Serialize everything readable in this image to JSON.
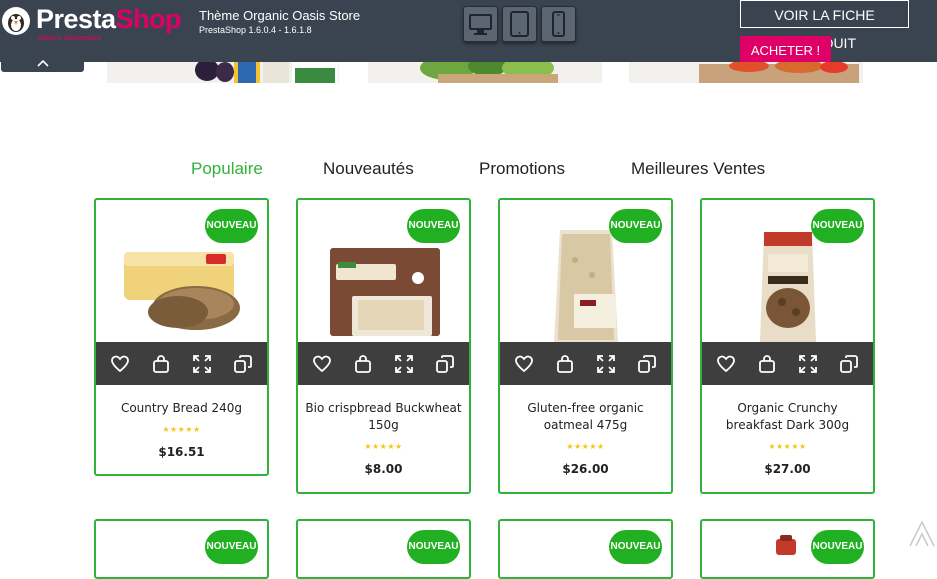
{
  "topbar": {
    "logo_main": "Presta",
    "logo_accent": "Shop",
    "logo_sub": "Addons Marketplace",
    "theme_title": "Thème Organic Oasis Store",
    "theme_version": "PrestaShop 1.6.0.4 - 1.6.1.8",
    "devices": [
      "desktop-icon",
      "tablet-icon",
      "mobile-icon"
    ],
    "view_product_label": "VOIR LA FICHE PRODUIT",
    "buy_label": "ACHETER !"
  },
  "tabs": [
    {
      "label": "Populaire",
      "active": true
    },
    {
      "label": "Nouveautés",
      "active": false
    },
    {
      "label": "Promotions",
      "active": false
    },
    {
      "label": "Meilleures Ventes",
      "active": false
    }
  ],
  "badge_label": "NOUVEAU",
  "stars": "★★★★★",
  "products": [
    {
      "name": "Country Bread 240g",
      "price": "$16.51"
    },
    {
      "name": "Bio crispbread Buckwheat 150g",
      "price": "$8.00"
    },
    {
      "name": "Gluten-free organic oatmeal 475g",
      "price": "$26.00"
    },
    {
      "name": "Organic Crunchy breakfast Dark 300g",
      "price": "$27.00"
    }
  ],
  "colors": {
    "accent": "#2fb33b",
    "badge": "#21b021",
    "topbar": "#3a4451",
    "brand_pink": "#df0067",
    "action_bar": "#3e3e3e",
    "stars": "#f5c518"
  }
}
